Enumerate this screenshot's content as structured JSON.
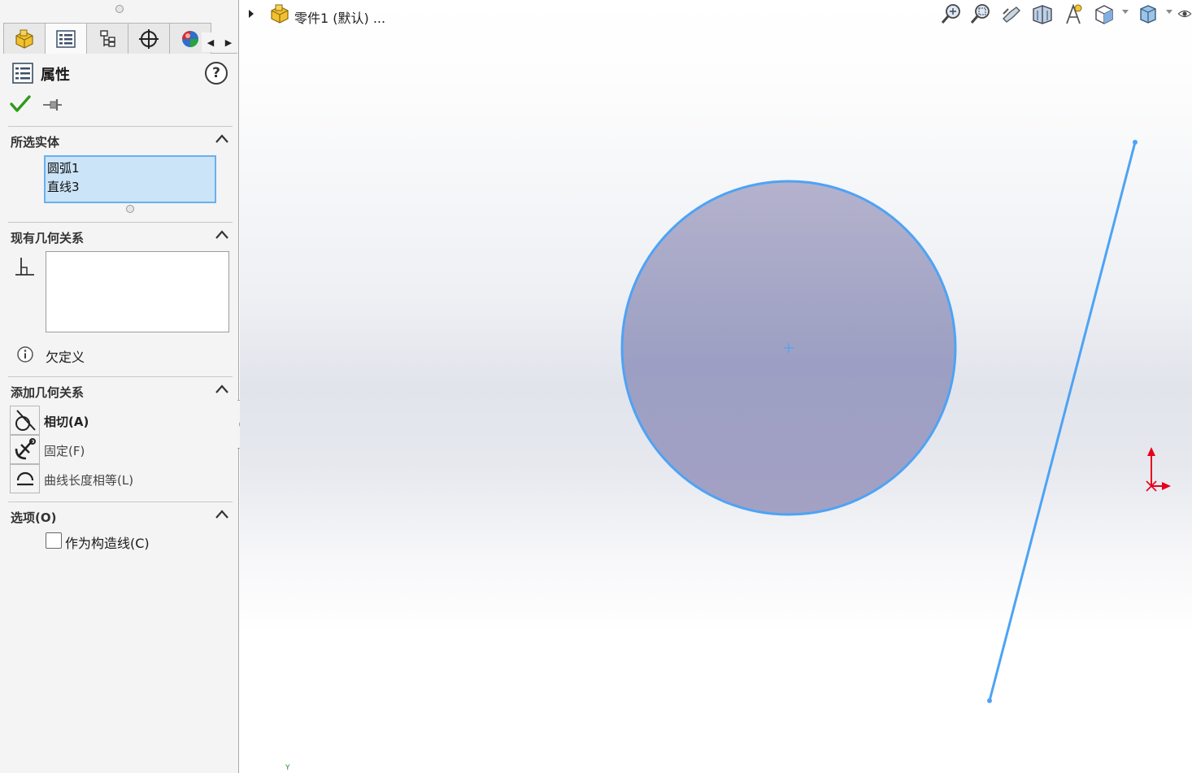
{
  "panel": {
    "property_manager_title": "属性",
    "help_label": "?",
    "sections": {
      "selected_entities": {
        "title": "所选实体",
        "items": [
          "圆弧1",
          "直线3"
        ]
      },
      "existing_relations": {
        "title": "现有几何关系",
        "status": "欠定义"
      },
      "add_relations": {
        "title": "添加几何关系",
        "items": [
          {
            "label": "相切(A)",
            "icon": "tangent-icon"
          },
          {
            "label": "固定(F)",
            "icon": "fix-icon"
          },
          {
            "label": "曲线长度相等(L)",
            "icon": "equal-curve-length-icon"
          }
        ]
      },
      "options": {
        "title": "选项(O)",
        "construction_label": "作为构造线(C)",
        "construction_checked": false
      }
    }
  },
  "graphics": {
    "document_title": "零件1 (默认) ...",
    "axis_label": "Y"
  },
  "colors": {
    "sketch_blue": "#4da3f5",
    "circle_fill": "#a3a6c6",
    "ok_green": "#2f9a1a",
    "triad_red": "#e8001c"
  }
}
